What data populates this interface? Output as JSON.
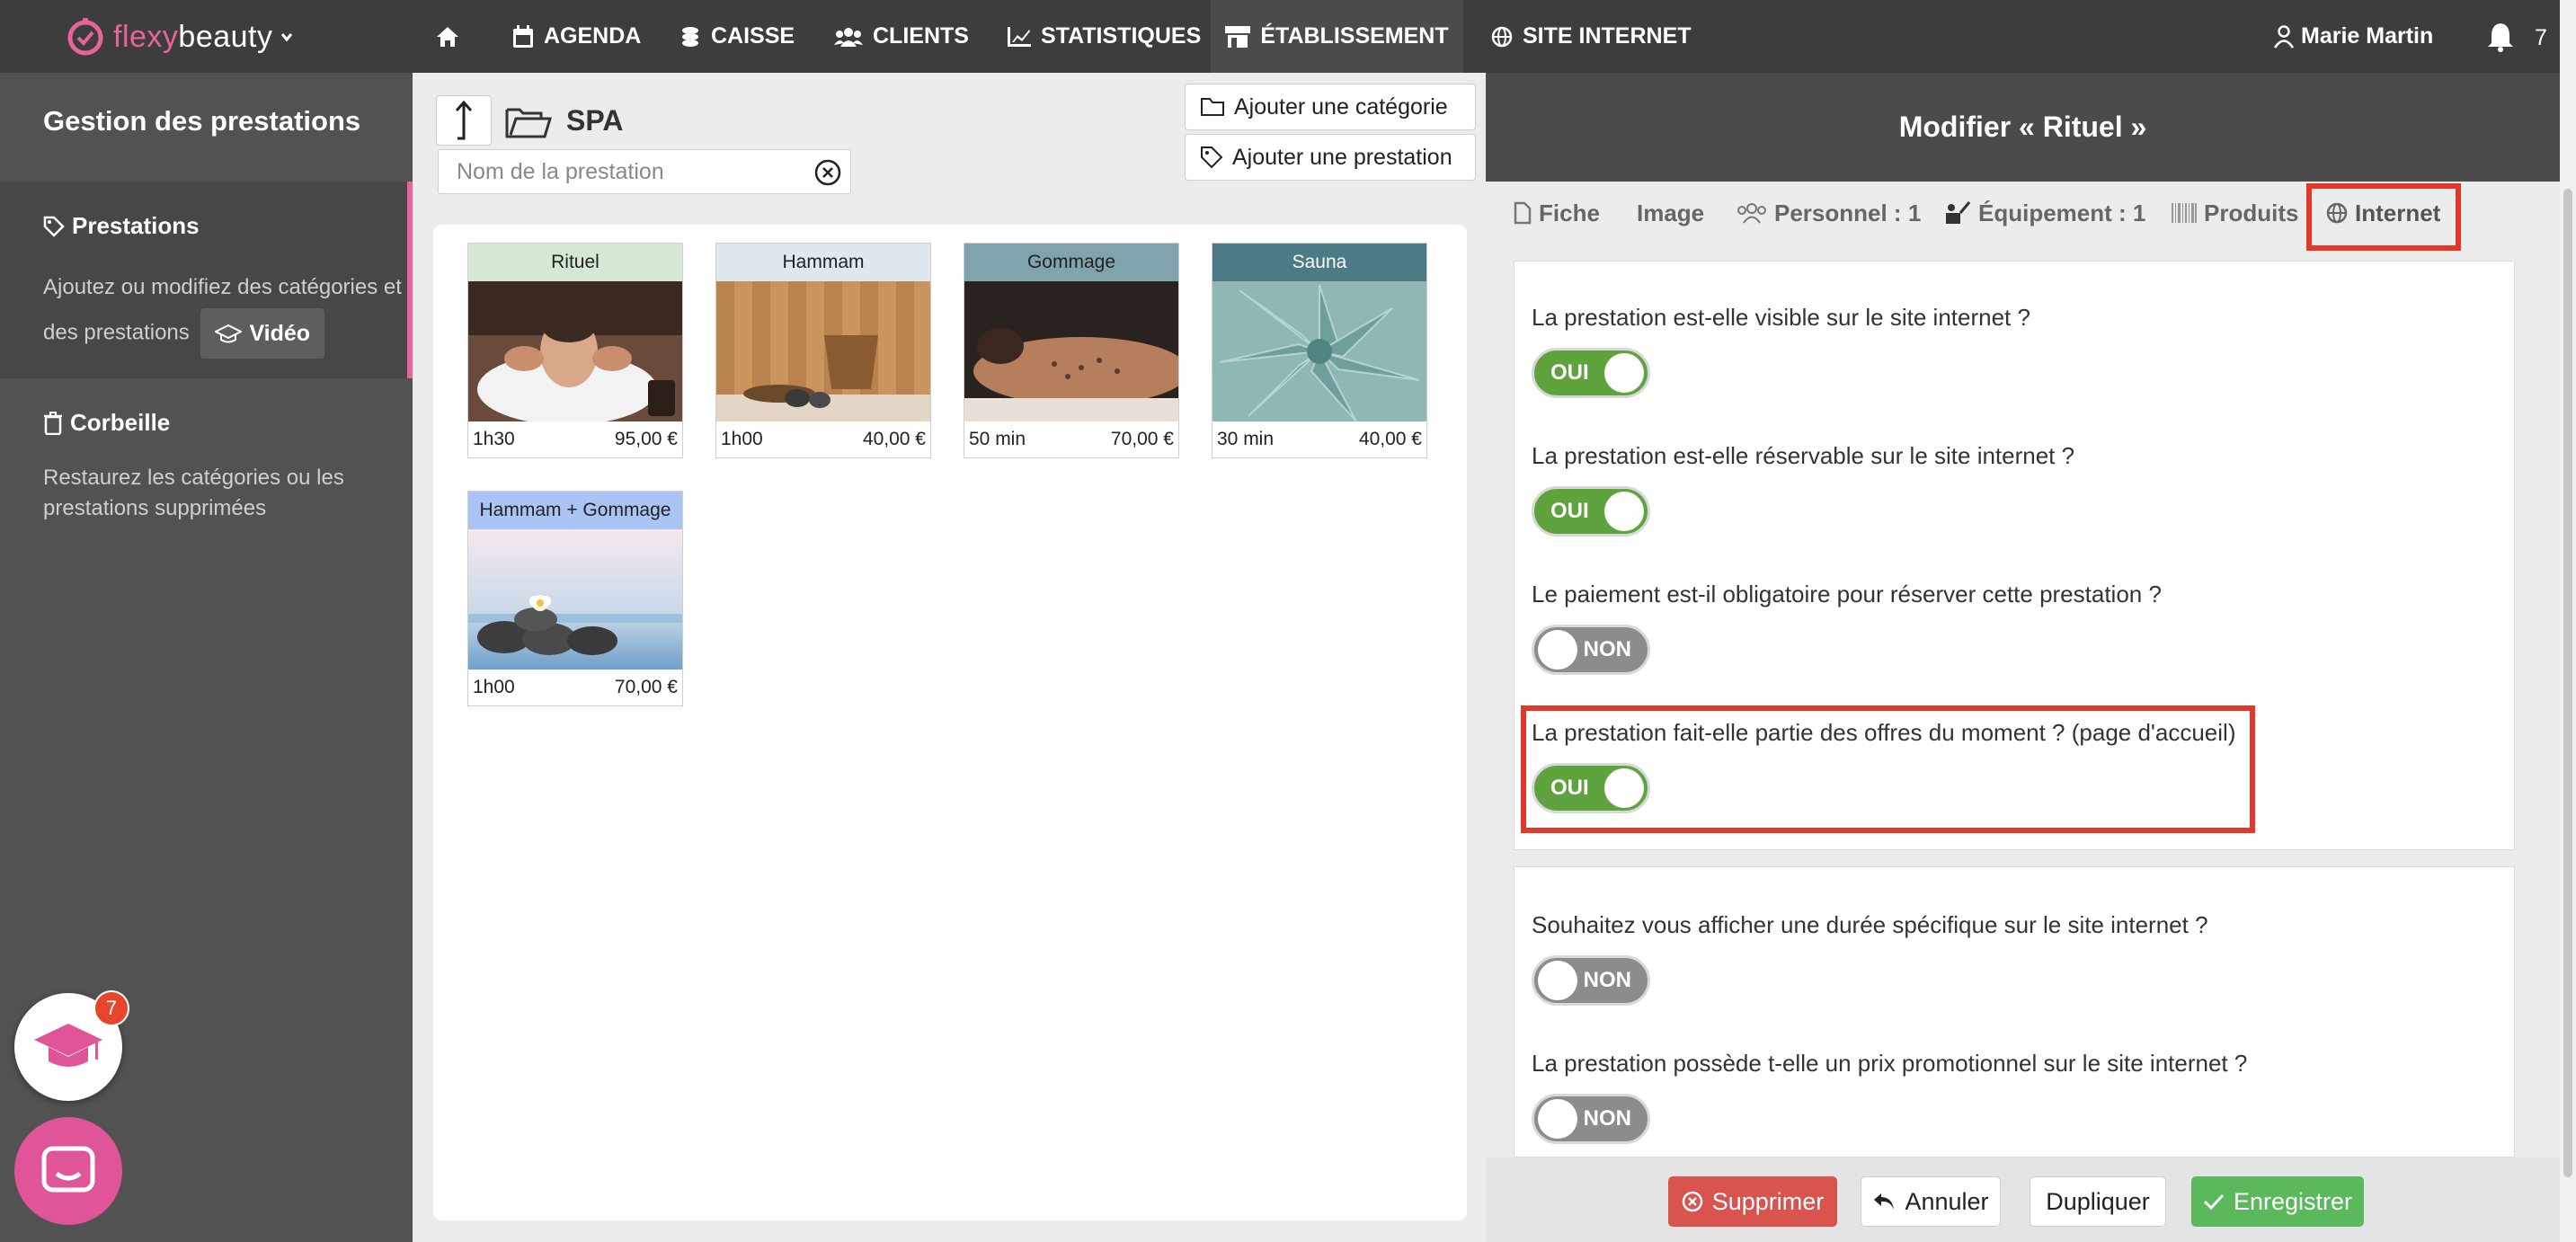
{
  "app": {
    "logo_text_pink": "flexy",
    "logo_text_white": "beauty"
  },
  "nav": {
    "items": [
      {
        "label": "AGENDA",
        "icon": "calendar-icon"
      },
      {
        "label": "CAISSE",
        "icon": "coins-icon"
      },
      {
        "label": "CLIENTS",
        "icon": "users-icon"
      },
      {
        "label": "STATISTIQUES",
        "icon": "chart-icon"
      },
      {
        "label": "ÉTABLISSEMENT",
        "icon": "store-icon"
      },
      {
        "label": "SITE INTERNET",
        "icon": "globe-icon"
      }
    ],
    "user": "Marie Martin",
    "notifications": "7"
  },
  "sidebar": {
    "title": "Gestion des prestations",
    "sections": [
      {
        "label": "Prestations",
        "description": "Ajoutez ou modifiez des catégories et des prestations",
        "video_label": "Vidéo"
      },
      {
        "label": "Corbeille",
        "description": "Restaurez les catégories ou les prestations supprimées"
      }
    ],
    "help_badge": "7"
  },
  "middle": {
    "folder": "SPA",
    "search_placeholder": "Nom de la prestation",
    "add_category": "Ajouter une catégorie",
    "add_service": "Ajouter une prestation",
    "cards": [
      {
        "name": "Rituel",
        "duration": "1h30",
        "price": "95,00 €",
        "color": "#d5e8d4"
      },
      {
        "name": "Hammam",
        "duration": "1h00",
        "price": "40,00 €",
        "color": "#dfe8ee"
      },
      {
        "name": "Gommage",
        "duration": "50 min",
        "price": "70,00 €",
        "color": "#7fa4ad"
      },
      {
        "name": "Sauna",
        "duration": "30 min",
        "price": "40,00 €",
        "color": "#4c7a87"
      },
      {
        "name": "Hammam + Gommage",
        "duration": "1h00",
        "price": "70,00 €",
        "color": "#a9c4f5"
      }
    ]
  },
  "right": {
    "title": "Modifier « Rituel »",
    "tabs": [
      {
        "label": "Fiche",
        "icon": "file-icon"
      },
      {
        "label": "Image",
        "icon": ""
      },
      {
        "label": "Personnel : 1",
        "icon": "team-icon"
      },
      {
        "label": "Équipement : 1",
        "icon": "equipment-icon"
      },
      {
        "label": "Produits",
        "icon": "barcode-icon"
      },
      {
        "label": "Internet",
        "icon": "globe-icon"
      }
    ],
    "questions": [
      {
        "text": "La prestation est-elle visible sur le site internet ?",
        "value": "OUI"
      },
      {
        "text": "La prestation est-elle réservable sur le site internet ?",
        "value": "OUI"
      },
      {
        "text": "Le paiement est-il obligatoire pour réserver cette prestation ?",
        "value": "NON"
      },
      {
        "text": "La prestation fait-elle partie des offres du moment ? (page d'accueil)",
        "value": "OUI"
      },
      {
        "text": "Souhaitez vous afficher une durée spécifique sur le site internet ?",
        "value": "NON"
      },
      {
        "text": "La prestation possède t-elle un prix promotionnel sur le site internet ?",
        "value": "NON"
      }
    ],
    "footer": {
      "delete": "Supprimer",
      "cancel": "Annuler",
      "duplicate": "Dupliquer",
      "save": "Enregistrer"
    }
  }
}
